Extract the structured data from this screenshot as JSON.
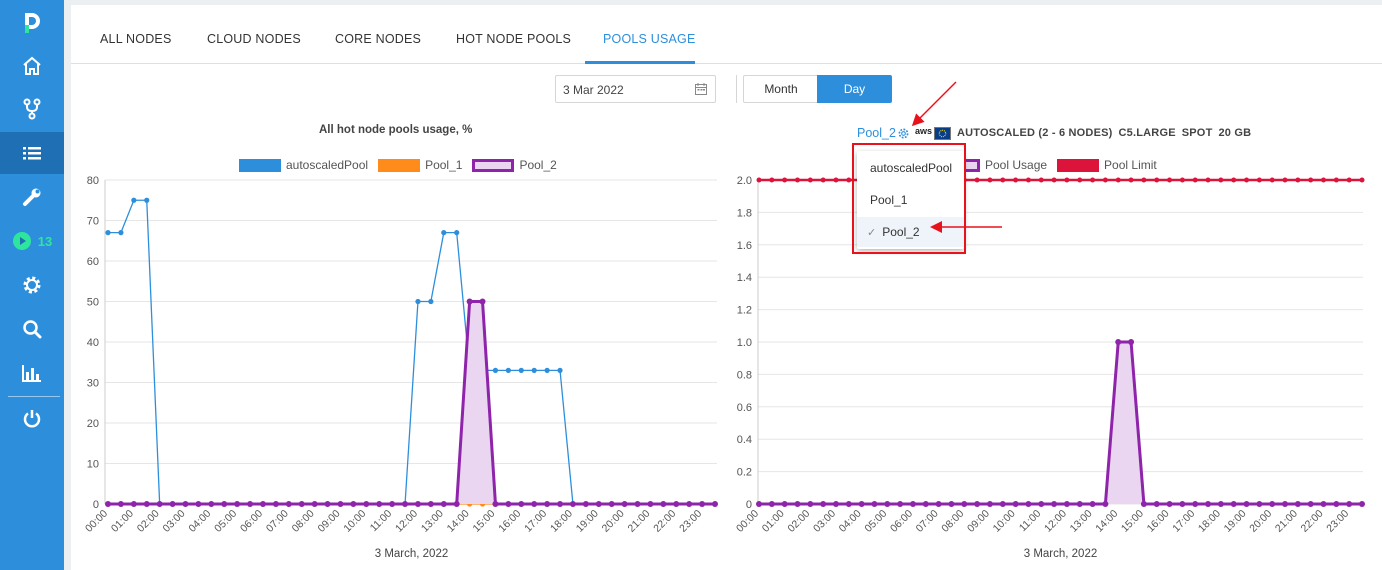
{
  "sidebar": {
    "badge_count": "13",
    "items": [
      {
        "icon": "logo-icon"
      },
      {
        "icon": "home-icon"
      },
      {
        "icon": "branch-icon"
      },
      {
        "icon": "list-icon"
      },
      {
        "icon": "wrench-icon"
      },
      {
        "icon": "play-icon"
      },
      {
        "icon": "gear-icon"
      },
      {
        "icon": "search-icon"
      },
      {
        "icon": "bar-chart-icon"
      },
      {
        "icon": "power-icon"
      }
    ],
    "colors": {
      "background": "#2d8fdc",
      "active": "#1e6fb3",
      "badge": "#2ee59d"
    }
  },
  "tabs": {
    "all_nodes": "ALL NODES",
    "cloud_nodes": "CLOUD NODES",
    "core_nodes": "CORE NODES",
    "hot_node_pools": "HOT NODE POOLS",
    "pools_usage": "POOLS USAGE",
    "active": "POOLS USAGE"
  },
  "controls": {
    "date_value": "3 Mar 2022",
    "month_label": "Month",
    "day_label": "Day",
    "selected_period": "Day"
  },
  "pool_header": {
    "pool_name": "Pool_2",
    "provider": "aws",
    "mode": "AUTOSCALED (2 - 6 NODES)",
    "instance_type": "C5.LARGE",
    "price_type": "SPOT",
    "disk": "20 GB"
  },
  "dropdown": {
    "items": [
      "autoscaledPool",
      "Pool_1",
      "Pool_2"
    ],
    "selected": "Pool_2",
    "check_mark": "✓"
  },
  "chart_data": [
    {
      "type": "line",
      "title": "All hot node pools usage, %",
      "xlabel": "3 March, 2022",
      "ylabel": "",
      "ylim": [
        0,
        80
      ],
      "yticks": [
        "0",
        "10",
        "20",
        "30",
        "40",
        "50",
        "60",
        "70",
        "80"
      ],
      "categories": [
        "00:00",
        "00:30",
        "01:00",
        "01:30",
        "02:00",
        "02:30",
        "03:00",
        "03:30",
        "04:00",
        "04:30",
        "05:00",
        "05:30",
        "06:00",
        "06:30",
        "07:00",
        "07:30",
        "08:00",
        "08:30",
        "09:00",
        "09:30",
        "10:00",
        "10:30",
        "11:00",
        "11:30",
        "12:00",
        "12:30",
        "13:00",
        "13:30",
        "14:00",
        "14:30",
        "15:00",
        "15:30",
        "16:00",
        "16:30",
        "17:00",
        "17:30",
        "18:00",
        "18:30",
        "19:00",
        "19:30",
        "20:00",
        "20:30",
        "21:00",
        "21:30",
        "22:00",
        "22:30",
        "23:00",
        "23:30"
      ],
      "tick_labels": [
        "00:00",
        "01:00",
        "02:00",
        "03:00",
        "04:00",
        "05:00",
        "06:00",
        "07:00",
        "08:00",
        "09:00",
        "10:00",
        "11:00",
        "12:00",
        "13:00",
        "14:00",
        "15:00",
        "16:00",
        "17:00",
        "18:00",
        "19:00",
        "20:00",
        "21:00",
        "22:00",
        "23:00"
      ],
      "grid": true,
      "legend_position": "top",
      "series": [
        {
          "name": "autoscaledPool",
          "color": "#2d8fdc",
          "values": [
            67,
            67,
            75,
            75,
            0,
            0,
            0,
            0,
            0,
            0,
            0,
            0,
            0,
            0,
            0,
            0,
            0,
            0,
            0,
            0,
            0,
            0,
            0,
            0,
            50,
            50,
            67,
            67,
            33,
            33,
            33,
            33,
            33,
            33,
            33,
            33,
            0,
            0,
            0,
            0,
            0,
            0,
            0,
            0,
            0,
            0,
            0,
            0
          ]
        },
        {
          "name": "Pool_1",
          "color": "#ff8c1a",
          "values": [
            0,
            0,
            0,
            0,
            0,
            0,
            0,
            0,
            0,
            0,
            0,
            0,
            0,
            0,
            0,
            0,
            0,
            0,
            0,
            0,
            0,
            0,
            0,
            0,
            0,
            0,
            0,
            0,
            0,
            0,
            0,
            0,
            0,
            0,
            0,
            0,
            0,
            0,
            0,
            0,
            0,
            0,
            0,
            0,
            0,
            0,
            0,
            0
          ]
        },
        {
          "name": "Pool_2",
          "color": "#8e24aa",
          "fill": "#ead6f0",
          "values": [
            0,
            0,
            0,
            0,
            0,
            0,
            0,
            0,
            0,
            0,
            0,
            0,
            0,
            0,
            0,
            0,
            0,
            0,
            0,
            0,
            0,
            0,
            0,
            0,
            0,
            0,
            0,
            0,
            50,
            50,
            0,
            0,
            0,
            0,
            0,
            0,
            0,
            0,
            0,
            0,
            0,
            0,
            0,
            0,
            0,
            0,
            0,
            0
          ]
        }
      ]
    },
    {
      "type": "line",
      "title": "",
      "xlabel": "3 March, 2022",
      "ylabel": "",
      "ylim": [
        0,
        2.0
      ],
      "yticks": [
        "0",
        "0.2",
        "0.4",
        "0.6",
        "0.8",
        "1.0",
        "1.2",
        "1.4",
        "1.6",
        "1.8",
        "2.0"
      ],
      "categories": [
        "00:00",
        "00:30",
        "01:00",
        "01:30",
        "02:00",
        "02:30",
        "03:00",
        "03:30",
        "04:00",
        "04:30",
        "05:00",
        "05:30",
        "06:00",
        "06:30",
        "07:00",
        "07:30",
        "08:00",
        "08:30",
        "09:00",
        "09:30",
        "10:00",
        "10:30",
        "11:00",
        "11:30",
        "12:00",
        "12:30",
        "13:00",
        "13:30",
        "14:00",
        "14:30",
        "15:00",
        "15:30",
        "16:00",
        "16:30",
        "17:00",
        "17:30",
        "18:00",
        "18:30",
        "19:00",
        "19:30",
        "20:00",
        "20:30",
        "21:00",
        "21:30",
        "22:00",
        "22:30",
        "23:00",
        "23:30"
      ],
      "tick_labels": [
        "00:00",
        "01:00",
        "02:00",
        "03:00",
        "04:00",
        "05:00",
        "06:00",
        "07:00",
        "08:00",
        "09:00",
        "10:00",
        "11:00",
        "12:00",
        "13:00",
        "14:00",
        "15:00",
        "16:00",
        "17:00",
        "18:00",
        "19:00",
        "20:00",
        "21:00",
        "22:00",
        "23:00"
      ],
      "grid": true,
      "legend_position": "top",
      "series": [
        {
          "name": "Pool Usage",
          "color": "#8e24aa",
          "fill": "#ead6f0",
          "values": [
            0,
            0,
            0,
            0,
            0,
            0,
            0,
            0,
            0,
            0,
            0,
            0,
            0,
            0,
            0,
            0,
            0,
            0,
            0,
            0,
            0,
            0,
            0,
            0,
            0,
            0,
            0,
            0,
            1,
            1,
            0,
            0,
            0,
            0,
            0,
            0,
            0,
            0,
            0,
            0,
            0,
            0,
            0,
            0,
            0,
            0,
            0,
            0
          ]
        },
        {
          "name": "Pool Limit",
          "color": "#dc143c",
          "values": [
            2,
            2,
            2,
            2,
            2,
            2,
            2,
            2,
            2,
            2,
            2,
            2,
            2,
            2,
            2,
            2,
            2,
            2,
            2,
            2,
            2,
            2,
            2,
            2,
            2,
            2,
            2,
            2,
            2,
            2,
            2,
            2,
            2,
            2,
            2,
            2,
            2,
            2,
            2,
            2,
            2,
            2,
            2,
            2,
            2,
            2,
            2,
            2
          ]
        }
      ]
    }
  ]
}
